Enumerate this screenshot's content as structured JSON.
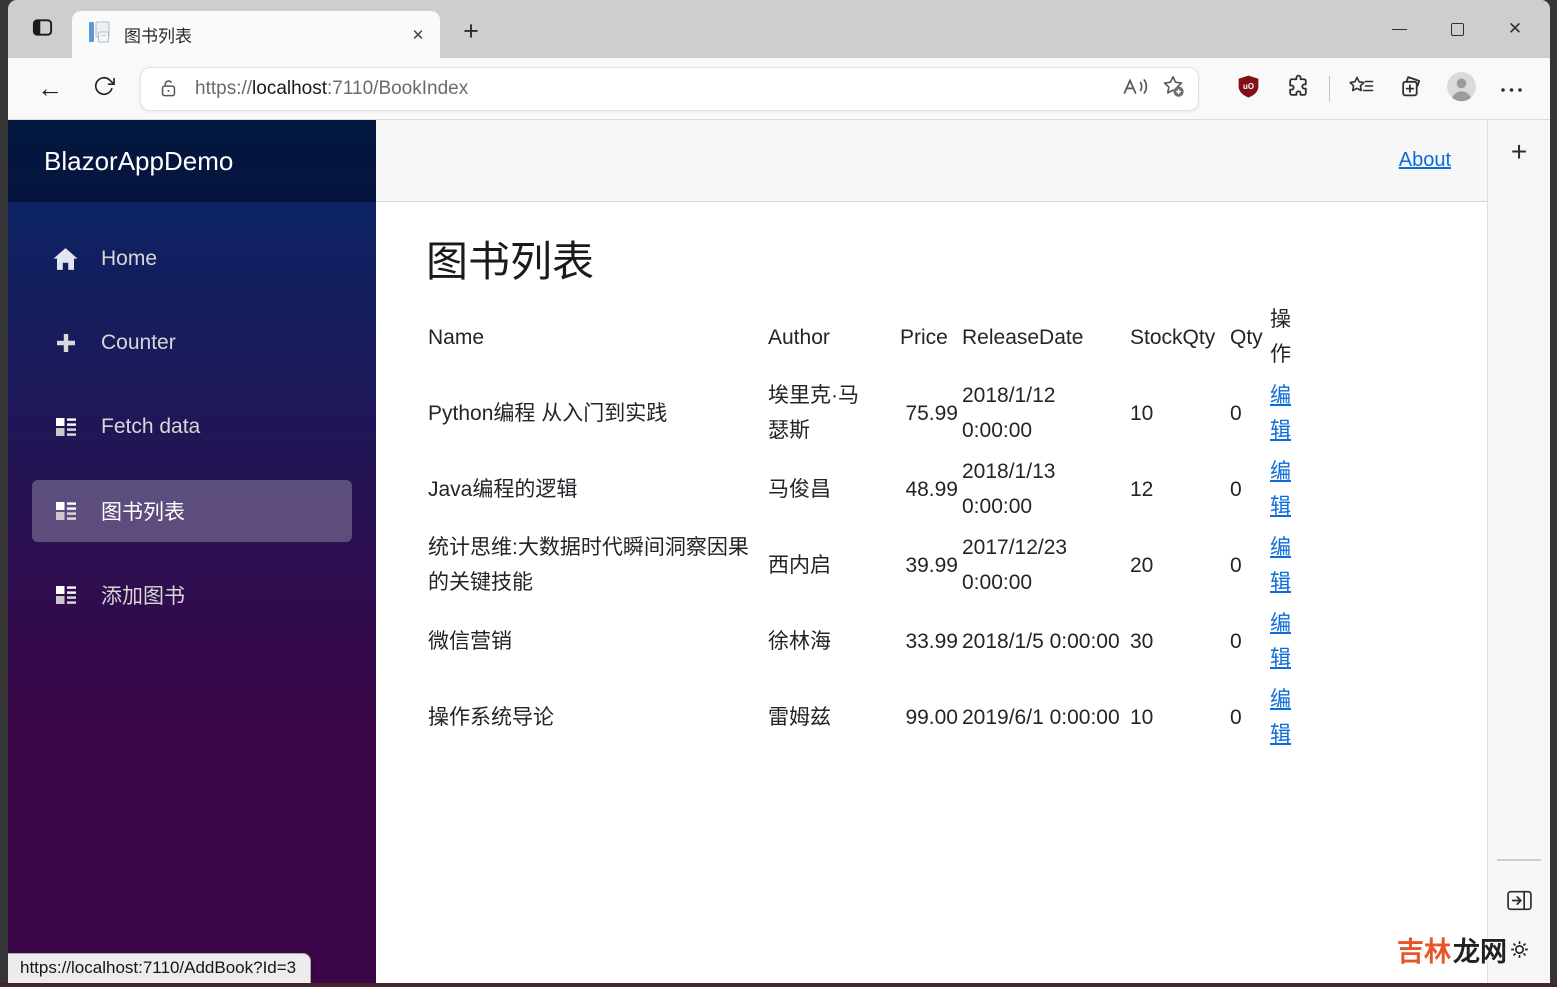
{
  "browser": {
    "tab_title": "图书列表",
    "tab_close_glyph": "✕",
    "new_tab_glyph": "+",
    "back_glyph": "←",
    "url": {
      "scheme": "https://",
      "host": "localhost",
      "rest": ":7110/BookIndex"
    },
    "ublock_badge": "uO",
    "window_close_glyph": "✕",
    "status_url": "https://localhost:7110/AddBook?Id=3",
    "rail_new_tab_glyph": "+"
  },
  "app": {
    "brand": "BlazorAppDemo",
    "about_label": "About",
    "nav": [
      {
        "label": "Home"
      },
      {
        "label": "Counter"
      },
      {
        "label": "Fetch data"
      },
      {
        "label": "图书列表"
      },
      {
        "label": "添加图书"
      }
    ],
    "page_title": "图书列表",
    "table": {
      "columns": [
        "Name",
        "Author",
        "Price",
        "ReleaseDate",
        "StockQty",
        "Qty",
        "操作"
      ],
      "rows": [
        {
          "name": "Python编程 从入门到实践",
          "author": "埃里克·马瑟斯",
          "price": "75.99",
          "release_date": "2018/1/12 0:00:00",
          "stock_qty": "10",
          "qty": "0",
          "action": "编辑"
        },
        {
          "name": "Java编程的逻辑",
          "author": "马俊昌",
          "price": "48.99",
          "release_date": "2018/1/13 0:00:00",
          "stock_qty": "12",
          "qty": "0",
          "action": "编辑"
        },
        {
          "name": "统计思维:大数据时代瞬间洞察因果的关键技能",
          "author": "西内启",
          "price": "39.99",
          "release_date": "2017/12/23 0:00:00",
          "stock_qty": "20",
          "qty": "0",
          "action": "编辑"
        },
        {
          "name": "微信营销",
          "author": "徐林海",
          "price": "33.99",
          "release_date": "2018/1/5 0:00:00",
          "stock_qty": "30",
          "qty": "0",
          "action": "编辑"
        },
        {
          "name": "操作系统导论",
          "author": "雷姆兹",
          "price": "99.00",
          "release_date": "2019/6/1 0:00:00",
          "stock_qty": "10",
          "qty": "0",
          "action": "编辑"
        }
      ]
    }
  },
  "watermark": {
    "orange_text": "吉林",
    "dark_text": "龙网"
  }
}
